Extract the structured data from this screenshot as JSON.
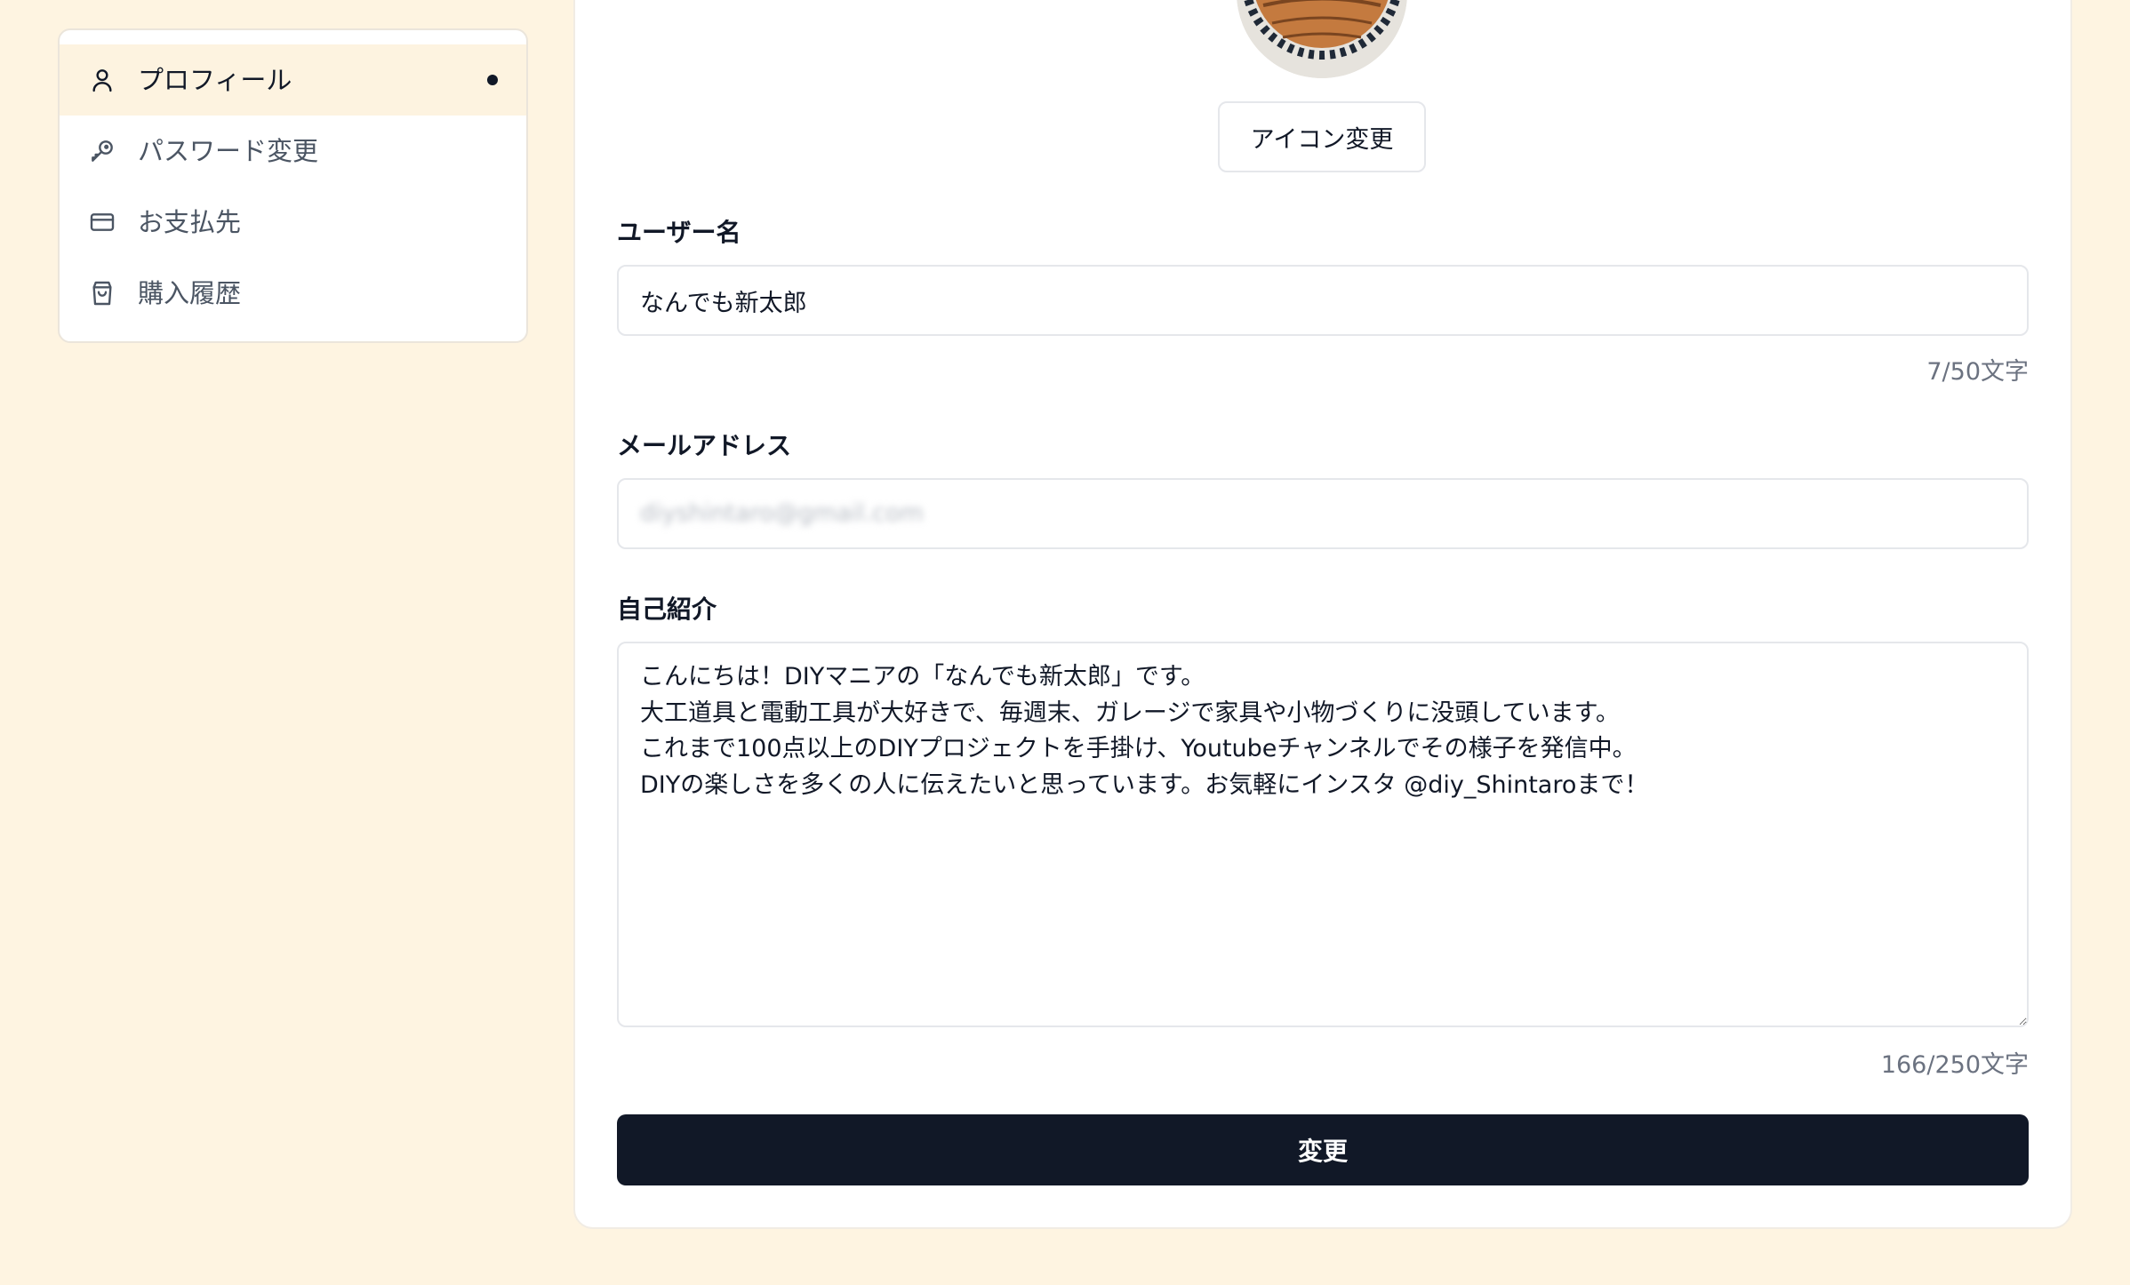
{
  "sidebar": {
    "items": [
      {
        "label": "プロフィール",
        "icon": "user-icon",
        "active": true
      },
      {
        "label": "パスワード変更",
        "icon": "key-icon",
        "active": false
      },
      {
        "label": "お支払先",
        "icon": "credit-card-icon",
        "active": false
      },
      {
        "label": "購入履歴",
        "icon": "shopping-bag-icon",
        "active": false
      }
    ]
  },
  "profile": {
    "avatar_icon": "saw-blade-logo",
    "change_icon_label": "アイコン変更",
    "username": {
      "label": "ユーザー名",
      "value": "なんでも新太郎",
      "counter": "7/50文字"
    },
    "email": {
      "label": "メールアドレス",
      "value": "diyshintaro@gmail.com"
    },
    "bio": {
      "label": "自己紹介",
      "value": "こんにちは！DIYマニアの「なんでも新太郎」です。\n大工道具と電動工具が大好きで、毎週末、ガレージで家具や小物づくりに没頭しています。\nこれまで100点以上のDIYプロジェクトを手掛け、Youtubeチャンネルでその様子を発信中。\nDIYの楽しさを多くの人に伝えたいと思っています。お気軽にインスタ @diy_Shintaroまで！",
      "counter": "166/250文字"
    },
    "submit_label": "変更"
  },
  "colors": {
    "background": "#fef4e1",
    "active_item": "#fdf3e0",
    "primary_button": "#111827"
  }
}
